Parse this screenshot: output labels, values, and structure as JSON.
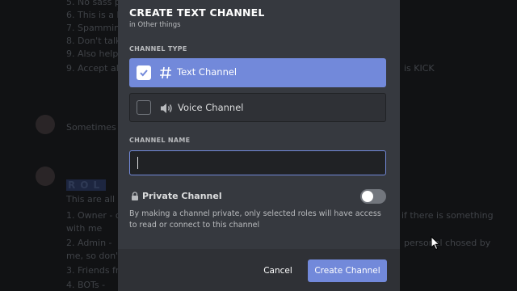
{
  "background": {
    "lines_top": [
      {
        "text": "5. No sass p",
        "right": ""
      },
      {
        "text": "6. This is a b",
        "right": ""
      },
      {
        "text": "7. Spammin",
        "right": ""
      },
      {
        "text": "8. Don't talk",
        "right": ""
      },
      {
        "text": "9. Also help",
        "right": ""
      },
      {
        "text": "9. Accept al",
        "right": "is KICK"
      }
    ],
    "message_snippet": "Sometimes",
    "roles_title": "ROL",
    "lines_bottom": [
      {
        "text": "This are all",
        "right": ""
      },
      {
        "text": "1. Owner - o",
        "right": "if there is something"
      },
      {
        "text": "with me",
        "right": ""
      },
      {
        "text": "2. Admin -",
        "right": "personal chosed by"
      },
      {
        "text": "me, so don'",
        "right": ""
      },
      {
        "text": "3. Friends fr",
        "right": ""
      },
      {
        "text": "4. BOTs -",
        "right": ""
      }
    ]
  },
  "modal": {
    "title": "CREATE TEXT CHANNEL",
    "subtitle": "in Other things",
    "channel_type_label": "CHANNEL TYPE",
    "options": [
      {
        "label": "Text Channel",
        "icon": "hash-icon",
        "selected": true
      },
      {
        "label": "Voice Channel",
        "icon": "speaker-icon",
        "selected": false
      }
    ],
    "channel_name_label": "CHANNEL NAME",
    "channel_name_value": "",
    "private_label": "Private Channel",
    "private_enabled": false,
    "private_description": "By making a channel private, only selected roles will have access to read or connect to this channel",
    "cancel_label": "Cancel",
    "create_label": "Create Channel"
  },
  "colors": {
    "accent": "#7289da",
    "modal_bg": "#36393f",
    "footer_bg": "#2f3136"
  }
}
